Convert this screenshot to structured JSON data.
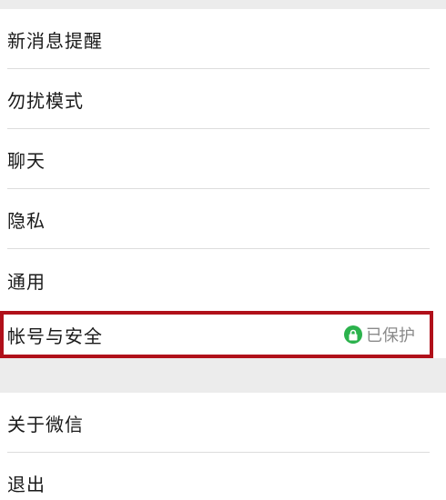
{
  "settings": {
    "items": [
      {
        "label": "新消息提醒"
      },
      {
        "label": "勿扰模式"
      },
      {
        "label": "聊天"
      },
      {
        "label": "隐私"
      },
      {
        "label": "通用"
      },
      {
        "label": "帐号与安全",
        "status": "已保护",
        "status_icon": "lock-icon"
      }
    ],
    "secondary_items": [
      {
        "label": "关于微信"
      },
      {
        "label": "退出"
      }
    ]
  },
  "colors": {
    "background": "#ececec",
    "row_background": "#ffffff",
    "divider": "#dcdcdc",
    "highlight_border": "#b0101a",
    "protected_badge": "#2bb24c",
    "status_text": "#8a8a8a"
  }
}
